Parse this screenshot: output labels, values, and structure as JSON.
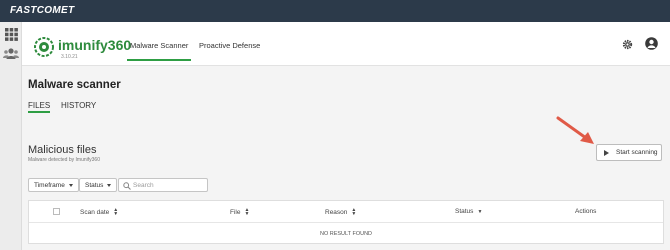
{
  "topbar": {
    "brand": "FASTCOMET"
  },
  "header": {
    "product": "imunify360",
    "version": "3.10.21",
    "tabs": [
      {
        "label": "Malware Scanner",
        "active": true
      },
      {
        "label": "Proactive Defense",
        "active": false
      }
    ]
  },
  "page": {
    "title": "Malware scanner",
    "subtabs": [
      {
        "label": "FILES",
        "active": true
      },
      {
        "label": "HISTORY",
        "active": false
      }
    ]
  },
  "section": {
    "title": "Malicious files",
    "subtitle": "Malware detected by Imunify360",
    "scan_button": "Start scanning"
  },
  "filters": {
    "timeframe": "Timeframe",
    "status": "Status",
    "search_placeholder": "Search"
  },
  "table": {
    "columns": [
      {
        "label": "Scan date",
        "sort": "both"
      },
      {
        "label": "File",
        "sort": "both"
      },
      {
        "label": "Reason",
        "sort": "both"
      },
      {
        "label": "Status",
        "sort": "down"
      },
      {
        "label": "Actions",
        "sort": "none"
      }
    ],
    "empty_message": "NO RESULT FOUND"
  },
  "colors": {
    "accent": "#2e9e44",
    "topbar": "#2c3a4a",
    "arrow": "#e05a47"
  },
  "icons": [
    "grid-icon",
    "users-icon",
    "shield-logo-icon",
    "gear-icon",
    "user-avatar-icon",
    "play-icon",
    "search-icon",
    "sort-icon",
    "caret-down-icon"
  ]
}
